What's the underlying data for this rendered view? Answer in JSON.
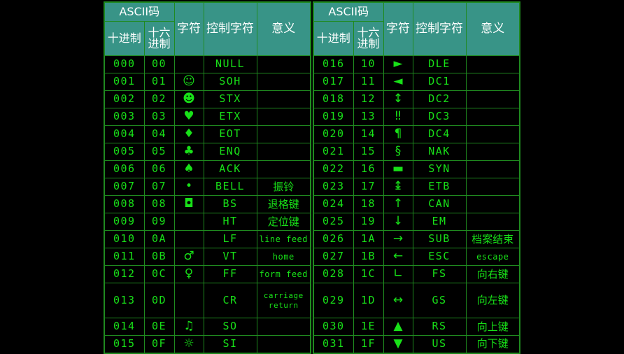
{
  "page": {
    "background_color": "#000000",
    "text_color": "#18e018",
    "grid_color": "#1f8a1f",
    "header_bg_color": "#389487",
    "header_text_color": "#ffffff"
  },
  "header": {
    "ascii_title": "ASCII码",
    "col_decimal": "十进制",
    "col_hex": "十六进制",
    "col_char": "字符",
    "col_control": "控制字符",
    "col_meaning": "意义"
  },
  "tables": [
    {
      "id": "left",
      "rows": [
        {
          "dec": "000",
          "hex": "00",
          "char": "",
          "ctrl": "NULL",
          "meaning": "",
          "meaning_style": ""
        },
        {
          "dec": "001",
          "hex": "01",
          "char": "☺",
          "ctrl": "SOH",
          "meaning": "",
          "meaning_style": ""
        },
        {
          "dec": "002",
          "hex": "02",
          "char": "☻",
          "ctrl": "STX",
          "meaning": "",
          "meaning_style": ""
        },
        {
          "dec": "003",
          "hex": "03",
          "char": "♥",
          "ctrl": "ETX",
          "meaning": "",
          "meaning_style": ""
        },
        {
          "dec": "004",
          "hex": "04",
          "char": "♦",
          "ctrl": "EOT",
          "meaning": "",
          "meaning_style": ""
        },
        {
          "dec": "005",
          "hex": "05",
          "char": "♣",
          "ctrl": "ENQ",
          "meaning": "",
          "meaning_style": ""
        },
        {
          "dec": "006",
          "hex": "06",
          "char": "♠",
          "ctrl": "ACK",
          "meaning": "",
          "meaning_style": ""
        },
        {
          "dec": "007",
          "hex": "07",
          "char": "•",
          "ctrl": "BELL",
          "meaning": "振铃",
          "meaning_style": ""
        },
        {
          "dec": "008",
          "hex": "08",
          "char": "◘",
          "ctrl": "BS",
          "meaning": "退格键",
          "meaning_style": ""
        },
        {
          "dec": "009",
          "hex": "09",
          "char": "",
          "ctrl": "HT",
          "meaning": "定位键",
          "meaning_style": ""
        },
        {
          "dec": "010",
          "hex": "0A",
          "char": "",
          "ctrl": "LF",
          "meaning": "line feed",
          "meaning_style": "latin"
        },
        {
          "dec": "011",
          "hex": "0B",
          "char": "♂",
          "ctrl": "VT",
          "meaning": "home",
          "meaning_style": "latin"
        },
        {
          "dec": "012",
          "hex": "0C",
          "char": "♀",
          "ctrl": "FF",
          "meaning": "form feed",
          "meaning_style": "latin"
        },
        {
          "dec": "013",
          "hex": "0D",
          "char": "",
          "ctrl": "CR",
          "meaning": "carriage return",
          "meaning_style": "latin",
          "tall": true
        },
        {
          "dec": "014",
          "hex": "0E",
          "char": "♫",
          "ctrl": "SO",
          "meaning": "",
          "meaning_style": ""
        },
        {
          "dec": "015",
          "hex": "0F",
          "char": "☼",
          "ctrl": "SI",
          "meaning": "",
          "meaning_style": ""
        }
      ]
    },
    {
      "id": "right",
      "rows": [
        {
          "dec": "016",
          "hex": "10",
          "char": "►",
          "ctrl": "DLE",
          "meaning": "",
          "meaning_style": ""
        },
        {
          "dec": "017",
          "hex": "11",
          "char": "◄",
          "ctrl": "DC1",
          "meaning": "",
          "meaning_style": ""
        },
        {
          "dec": "018",
          "hex": "12",
          "char": "↕",
          "ctrl": "DC2",
          "meaning": "",
          "meaning_style": ""
        },
        {
          "dec": "019",
          "hex": "13",
          "char": "‼",
          "ctrl": "DC3",
          "meaning": "",
          "meaning_style": ""
        },
        {
          "dec": "020",
          "hex": "14",
          "char": "¶",
          "ctrl": "DC4",
          "meaning": "",
          "meaning_style": ""
        },
        {
          "dec": "021",
          "hex": "15",
          "char": "§",
          "ctrl": "NAK",
          "meaning": "",
          "meaning_style": ""
        },
        {
          "dec": "022",
          "hex": "16",
          "char": "▬",
          "ctrl": "SYN",
          "meaning": "",
          "meaning_style": ""
        },
        {
          "dec": "023",
          "hex": "17",
          "char": "↨",
          "ctrl": "ETB",
          "meaning": "",
          "meaning_style": ""
        },
        {
          "dec": "024",
          "hex": "18",
          "char": "↑",
          "ctrl": "CAN",
          "meaning": "",
          "meaning_style": ""
        },
        {
          "dec": "025",
          "hex": "19",
          "char": "↓",
          "ctrl": "EM",
          "meaning": "",
          "meaning_style": ""
        },
        {
          "dec": "026",
          "hex": "1A",
          "char": "→",
          "ctrl": "SUB",
          "meaning": "档案结束",
          "meaning_style": ""
        },
        {
          "dec": "027",
          "hex": "1B",
          "char": "←",
          "ctrl": "ESC",
          "meaning": "escape",
          "meaning_style": "latin"
        },
        {
          "dec": "028",
          "hex": "1C",
          "char": "∟",
          "ctrl": "FS",
          "meaning": "向右键",
          "meaning_style": ""
        },
        {
          "dec": "029",
          "hex": "1D",
          "char": "↔",
          "ctrl": "GS",
          "meaning": "向左键",
          "meaning_style": "",
          "tall": true
        },
        {
          "dec": "030",
          "hex": "1E",
          "char": "▲",
          "ctrl": "RS",
          "meaning": "向上键",
          "meaning_style": ""
        },
        {
          "dec": "031",
          "hex": "1F",
          "char": "▼",
          "ctrl": "US",
          "meaning": "向下键",
          "meaning_style": ""
        }
      ]
    }
  ]
}
